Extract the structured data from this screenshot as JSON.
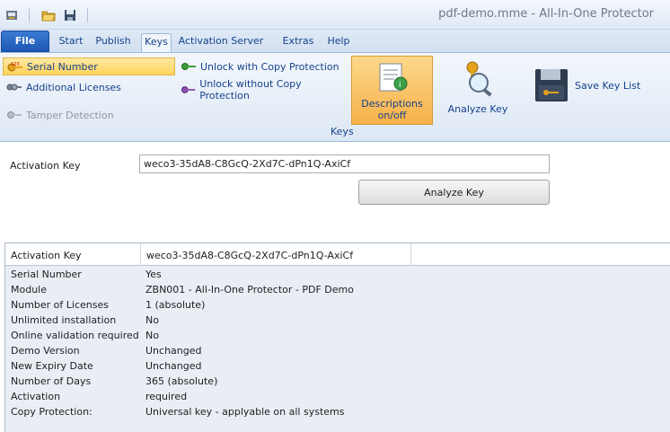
{
  "window": {
    "title": "pdf-demo.mme - All-In-One Protector"
  },
  "qat": [
    {
      "icon": "app-icon"
    },
    {
      "icon": "open-folder-icon"
    },
    {
      "icon": "save-icon"
    }
  ],
  "tabs": [
    "File",
    "Start",
    "Publish",
    "Keys",
    "Activation Server",
    "Extras",
    "Help"
  ],
  "ribbon": {
    "serial_number": "Serial Number",
    "additional_licenses": "Additional Licenses",
    "tamper_detection": "Tamper Detection",
    "unlock_with_copy": "Unlock with Copy Protection",
    "unlock_without_copy": "Unlock without Copy Protection",
    "descriptions_line1": "Descriptions",
    "descriptions_line2": "on/off",
    "analyze_key": "Analyze Key",
    "save_key_list": "Save Key List",
    "group_label": "Keys"
  },
  "form": {
    "activation_key_label": "Activation Key",
    "activation_key_value": "weco3-35dA8-C8GcQ-2Xd7C-dPn1Q-AxiCf",
    "analyze_button": "Analyze Key"
  },
  "results": {
    "header_key": "Activation Key",
    "header_value": "weco3-35dA8-C8GcQ-2Xd7C-dPn1Q-AxiCf",
    "rows": [
      {
        "k": "Serial Number",
        "v": "Yes"
      },
      {
        "k": "Module",
        "v": "ZBN001 - All-In-One Protector - PDF Demo"
      },
      {
        "k": "Number of Licenses",
        "v": "1 (absolute)"
      },
      {
        "k": "Unlimited installation",
        "v": "No"
      },
      {
        "k": "Online validation required",
        "v": "No"
      },
      {
        "k": "Demo Version",
        "v": "Unchanged"
      },
      {
        "k": "New Expiry Date",
        "v": "Unchanged"
      },
      {
        "k": "Number of Days",
        "v": "365 (absolute)"
      },
      {
        "k": "Activation",
        "v": "required"
      },
      {
        "k": "Copy Protection:",
        "v": "Universal key - applyable on all systems"
      }
    ]
  },
  "colors": {
    "accent": "#15428b",
    "selected": "#ffd35c",
    "file_tab": "#1c58b5"
  }
}
